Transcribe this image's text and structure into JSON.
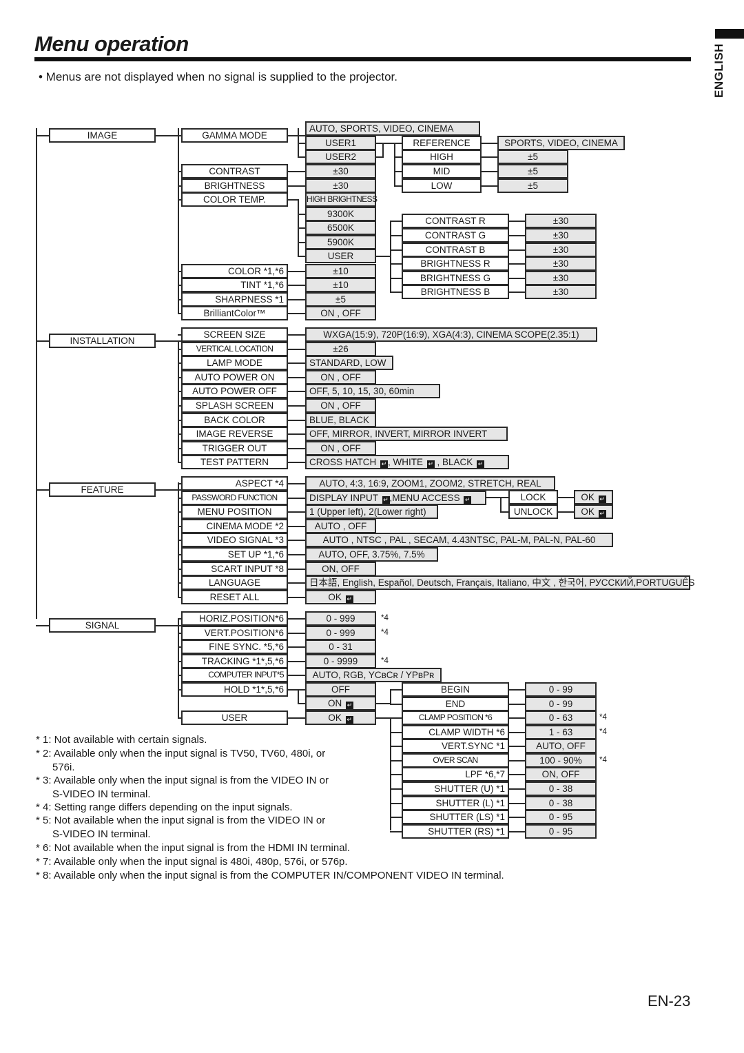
{
  "page": {
    "title": "Menu operation",
    "language_tab": "ENGLISH",
    "bullet_note": "•   Menus are not displayed when no signal is supplied to the projector.",
    "page_number": "EN-23"
  },
  "icons": {
    "enter": "↵"
  },
  "menu": {
    "image": {
      "label": "IMAGE",
      "items": [
        {
          "label": "GAMMA MODE",
          "value": "AUTO, SPORTS, VIDEO, CINEMA"
        },
        {
          "label": "CONTRAST",
          "value": "±30"
        },
        {
          "label": "BRIGHTNESS",
          "value": "±30"
        },
        {
          "label": "COLOR TEMP.",
          "value": "HIGH BRIGHTNESS"
        },
        {
          "label": "COLOR    *1,*6",
          "value": "±10"
        },
        {
          "label": "TINT      *1,*6",
          "value": "±10"
        },
        {
          "label": "SHARPNESS  *1",
          "value": "±5"
        },
        {
          "label": "BrilliantColor™",
          "value": "ON , OFF"
        }
      ],
      "gamma_users": [
        "USER1",
        "USER2"
      ],
      "gamma_user_menu": [
        {
          "label": "REFERENCE",
          "value": "SPORTS, VIDEO, CINEMA"
        },
        {
          "label": "HIGH",
          "value": "±5"
        },
        {
          "label": "MID",
          "value": "±5"
        },
        {
          "label": "LOW",
          "value": "±5"
        }
      ],
      "color_temp_options": [
        "9300K",
        "6500K",
        "5900K",
        "USER"
      ],
      "color_temp_user_menu": [
        {
          "label": "CONTRAST R",
          "value": "±30"
        },
        {
          "label": "CONTRAST G",
          "value": "±30"
        },
        {
          "label": "CONTRAST B",
          "value": "±30"
        },
        {
          "label": "BRIGHTNESS R",
          "value": "±30"
        },
        {
          "label": "BRIGHTNESS G",
          "value": "±30"
        },
        {
          "label": "BRIGHTNESS B",
          "value": "±30"
        }
      ]
    },
    "installation": {
      "label": "INSTALLATION",
      "items": [
        {
          "label": "SCREEN SIZE",
          "value": "WXGA(15:9), 720P(16:9), XGA(4:3), CINEMA SCOPE(2.35:1)"
        },
        {
          "label": "VERTICAL LOCATION",
          "value": "±26"
        },
        {
          "label": "LAMP MODE",
          "value": "STANDARD, LOW"
        },
        {
          "label": "AUTO POWER ON",
          "value": "ON , OFF"
        },
        {
          "label": "AUTO POWER OFF",
          "value": "OFF,  5,  10,  15,  30,  60min"
        },
        {
          "label": "SPLASH SCREEN",
          "value": "ON , OFF"
        },
        {
          "label": "BACK COLOR",
          "value": "BLUE, BLACK"
        },
        {
          "label": "IMAGE REVERSE",
          "value": "OFF, MIRROR, INVERT, MIRROR INVERT"
        },
        {
          "label": "TRIGGER OUT",
          "value": "ON , OFF"
        },
        {
          "label": "TEST PATTERN",
          "value": "CROSS HATCH ↵, WHITE ↵ , BLACK ↵"
        }
      ]
    },
    "feature": {
      "label": "FEATURE",
      "items": [
        {
          "label": "ASPECT     *4",
          "value": "AUTO, 4:3, 16:9, ZOOM1, ZOOM2, STRETCH, REAL"
        },
        {
          "label": "PASSWORD FUNCTION",
          "value": "DISPLAY INPUT ↵,MENU ACCESS  ↵"
        },
        {
          "label": "MENU POSITION",
          "value": "1 (Upper left), 2(Lower right)"
        },
        {
          "label": "CINEMA MODE *2",
          "value": "AUTO , OFF"
        },
        {
          "label": "VIDEO SIGNAL  *3",
          "value": "AUTO , NTSC , PAL , SECAM, 4.43NTSC, PAL-M, PAL-N, PAL-60"
        },
        {
          "label": "SET UP    *1,*6",
          "value": "AUTO, OFF, 3.75%, 7.5%"
        },
        {
          "label": "SCART INPUT  *8",
          "value": "ON, OFF"
        },
        {
          "label": "LANGUAGE",
          "value": "日本語, English, Español, Deutsch, Français, Italiano, 中文 , 한국어, РУССКИЙ,PORTUGUÊS"
        },
        {
          "label": "RESET ALL",
          "value": "OK ↵"
        }
      ],
      "password_submenu": [
        {
          "label": "LOCK",
          "value": "OK ↵"
        },
        {
          "label": "UNLOCK",
          "value": "OK ↵"
        }
      ]
    },
    "signal": {
      "label": "SIGNAL",
      "items": [
        {
          "label": "HORIZ.POSITION*6",
          "value": "0 - 999",
          "note": "*4"
        },
        {
          "label": "VERT.POSITION*6",
          "value": "0 - 999",
          "note": "*4"
        },
        {
          "label": "FINE SYNC. *5,*6",
          "value": "0 - 31",
          "note": ""
        },
        {
          "label": "TRACKING  *1*,5,*6",
          "value": "0 - 9999",
          "note": "*4"
        },
        {
          "label": "COMPUTER INPUT*5",
          "value": "AUTO, RGB, YCʙCʀ / YPʙPʀ",
          "note": ""
        },
        {
          "label": "HOLD  *1*,5,*6",
          "value": "OFF",
          "note": ""
        },
        {
          "label": "USER",
          "value": "OK ↵",
          "note": ""
        }
      ],
      "hold_on": "ON ↵",
      "hold_user_menu": [
        {
          "label": "BEGIN",
          "value": "0 - 99",
          "note": ""
        },
        {
          "label": "END",
          "value": "0 - 99",
          "note": ""
        }
      ],
      "user_menu": [
        {
          "label": "CLAMP POSITION *6",
          "value": "0 - 63",
          "note": "*4"
        },
        {
          "label": "CLAMP WIDTH  *6",
          "value": "1 - 63",
          "note": "*4"
        },
        {
          "label": "VERT.SYNC     *1",
          "value": "AUTO, OFF",
          "note": ""
        },
        {
          "label": "OVER SCAN",
          "value": "100 - 90%",
          "note": "*4"
        },
        {
          "label": "LPF        *6,*7",
          "value": "ON, OFF",
          "note": ""
        },
        {
          "label": "SHUTTER (U)   *1",
          "value": "0 - 38",
          "note": ""
        },
        {
          "label": "SHUTTER (L)   *1",
          "value": "0 - 38",
          "note": ""
        },
        {
          "label": "SHUTTER (LS)  *1",
          "value": "0 - 95",
          "note": ""
        },
        {
          "label": "SHUTTER (RS)  *1",
          "value": "0 - 95",
          "note": ""
        }
      ]
    }
  },
  "footnotes": [
    {
      "first": "* 1: Not available with certain signals.",
      "cont": ""
    },
    {
      "first": "* 2: Available only when the input signal is TV50, TV60, 480i, or",
      "cont": "576i."
    },
    {
      "first": "* 3: Available only when the input signal is from the VIDEO IN or",
      "cont": "S-VIDEO IN terminal."
    },
    {
      "first": "* 4: Setting range differs depending on the input signals.",
      "cont": ""
    },
    {
      "first": "* 5: Not available when the input signal is from the VIDEO IN or",
      "cont": "S-VIDEO IN terminal."
    },
    {
      "first": "* 6: Not available when the input signal is from the HDMI IN terminal.",
      "cont": ""
    },
    {
      "first": "* 7: Available only when the input signal is 480i, 480p, 576i, or 576p.",
      "cont": ""
    },
    {
      "first": "* 8: Available only when the input signal is from the COMPUTER IN/COMPONENT VIDEO IN terminal.",
      "cont": ""
    }
  ]
}
